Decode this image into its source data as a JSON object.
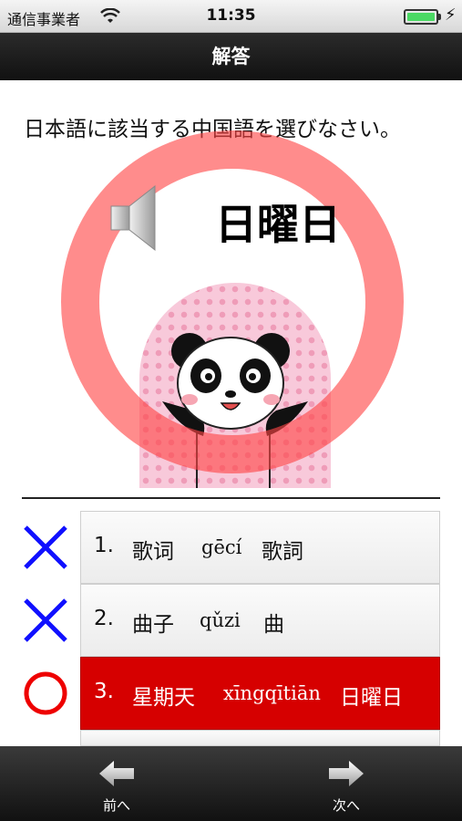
{
  "status_bar": {
    "carrier": "通信事業者",
    "time": "11:35",
    "battery_level": 1.0
  },
  "nav": {
    "title": "解答"
  },
  "question": {
    "prompt": "日本語に該当する中国語を選びなさい。",
    "word": "日曜日",
    "audio_icon": "speaker-icon",
    "mascot": "panda"
  },
  "colors": {
    "correct_ring": "#ff4646",
    "wrong_mark": "#1010ff",
    "correct_mark": "#ee0000",
    "selected_choice": "#d60000"
  },
  "choices": [
    {
      "number": "1.",
      "chinese": "歌词",
      "pinyin": "gēcí",
      "japanese": "歌詞",
      "result": "wrong",
      "result_icon": "cross-icon"
    },
    {
      "number": "2.",
      "chinese": "曲子",
      "pinyin": "qǔzi",
      "japanese": "曲",
      "result": "wrong",
      "result_icon": "cross-icon"
    },
    {
      "number": "3.",
      "chinese": "星期天",
      "pinyin": "xīngqītiān",
      "japanese": "日曜日",
      "result": "correct",
      "result_icon": "circle-icon"
    }
  ],
  "tabbar": {
    "prev_label": "前へ",
    "next_label": "次へ"
  }
}
